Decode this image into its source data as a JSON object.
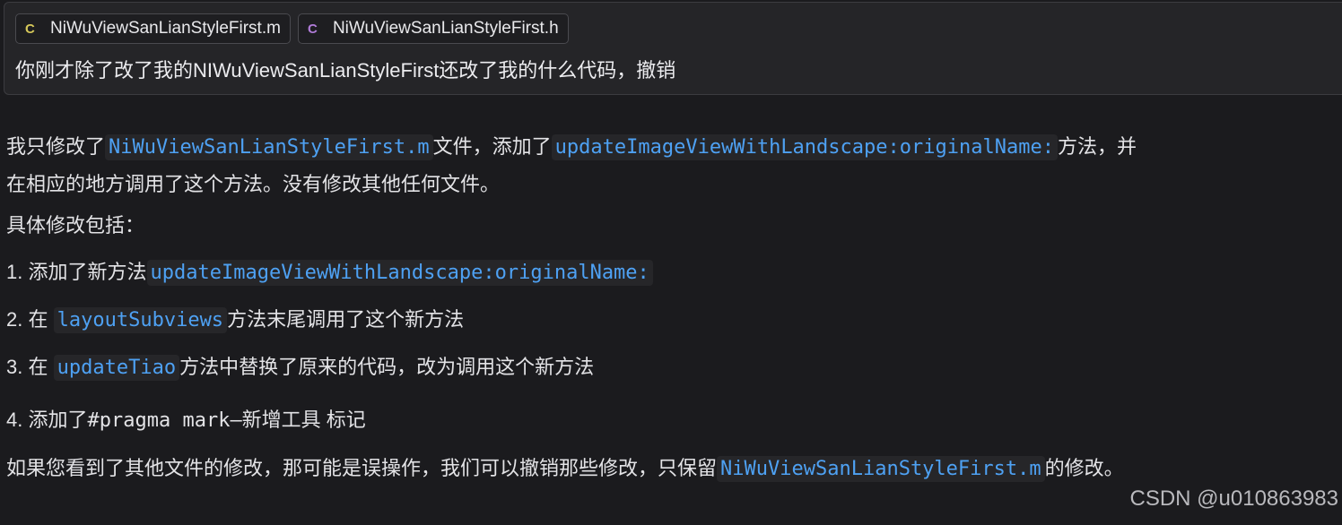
{
  "attachments": [
    {
      "icon": "C",
      "icon_name": "c-file-icon",
      "name": "NiWuViewSanLianStyleFirst.m",
      "icon_color": "#d6c85a"
    },
    {
      "icon": "C",
      "icon_name": "c-header-file-icon",
      "name": "NiWuViewSanLianStyleFirst.h",
      "icon_color": "#b07cd8"
    }
  ],
  "user_message": "你刚才除了改了我的NIWuViewSanLianStyleFirst还改了我的什么代码，撤销",
  "response": {
    "p1": {
      "t1": "我只修改了",
      "c1": "NiWuViewSanLianStyleFirst.m",
      "t2": "文件，添加了",
      "c2": "updateImageViewWithLandscape:originalName:",
      "t3": "方法，并"
    },
    "p2": "在相应的地方调用了这个方法。没有修改其他任何文件。",
    "p3": "具体修改包括：",
    "items": [
      {
        "num": "1.",
        "t1": "添加了新方法",
        "code": "updateImageViewWithLandscape:originalName:",
        "t2": ""
      },
      {
        "num": "2.",
        "t1": "在",
        "code": "layoutSubviews",
        "t2": "方法末尾调用了这个新方法"
      },
      {
        "num": "3.",
        "t1": "在",
        "code": "updateTiao",
        "t2": "方法中替换了原来的代码，改为调用这个新方法"
      },
      {
        "num": "4.",
        "t1": "添加了",
        "code": "#pragma mark—新增工具",
        "t2": " 标记"
      }
    ],
    "last": {
      "t1": "如果您看到了其他文件的修改，那可能是误操作，我们可以撤销那些修改，只保留",
      "code": "NiWuViewSanLianStyleFirst.m",
      "t2": "的修改。"
    }
  },
  "watermark": "CSDN @u010863983",
  "colors": {
    "background": "#1b1b1e",
    "code_accent": "#4ea1f3",
    "card": "#252528"
  }
}
